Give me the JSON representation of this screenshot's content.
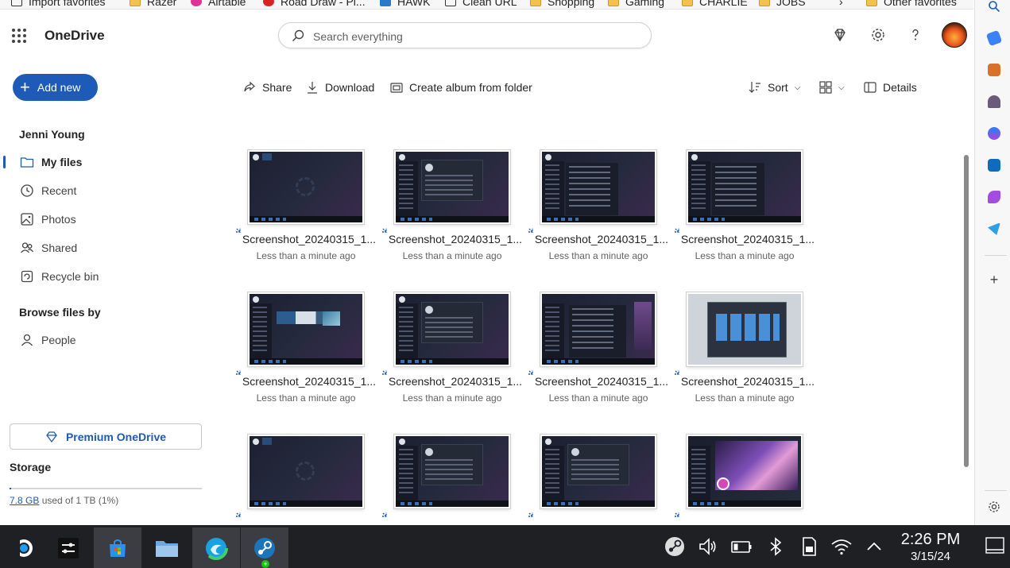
{
  "favorites_bar": {
    "items": [
      {
        "label": "Import favorites",
        "icon": "import-icon"
      },
      {
        "label": "Razer",
        "icon": "folder-icon"
      },
      {
        "label": "Airtable",
        "icon": "airtable-icon"
      },
      {
        "label": "Road Draw - Pl...",
        "icon": "roaddraw-icon"
      },
      {
        "label": "HAWK",
        "icon": "hawk-icon"
      },
      {
        "label": "Clean URL",
        "icon": "page-icon"
      },
      {
        "label": "Shopping",
        "icon": "folder-icon"
      },
      {
        "label": "Gaming",
        "icon": "folder-icon"
      },
      {
        "label": "CHARLIE",
        "icon": "folder-icon"
      },
      {
        "label": "JOBS",
        "icon": "folder-icon"
      },
      {
        "label": "Other favorites",
        "icon": "folder-icon"
      }
    ]
  },
  "header": {
    "app_name": "OneDrive",
    "search_placeholder": "Search everything"
  },
  "sidebar": {
    "add_new_label": "Add new",
    "user_name": "Jenni Young",
    "items": [
      {
        "label": "My files",
        "icon": "folder-icon",
        "active": true
      },
      {
        "label": "Recent",
        "icon": "clock-icon"
      },
      {
        "label": "Photos",
        "icon": "image-icon"
      },
      {
        "label": "Shared",
        "icon": "people-icon"
      },
      {
        "label": "Recycle bin",
        "icon": "trash-icon"
      }
    ],
    "browse_title": "Browse files by",
    "browse_items": [
      {
        "label": "People",
        "icon": "person-icon"
      }
    ],
    "premium_label": "Premium OneDrive",
    "storage_title": "Storage",
    "storage_used": "7.8 GB",
    "storage_rest": "used of 1 TB (1%)",
    "storage_fraction": 0.01
  },
  "commands": {
    "share": "Share",
    "download": "Download",
    "create_album": "Create album from folder",
    "sort": "Sort",
    "details": "Details"
  },
  "files": [
    {
      "name": "Screenshot_20240315_1...",
      "date": "Less than a minute ago",
      "thumb": "desktop"
    },
    {
      "name": "Screenshot_20240315_1...",
      "date": "Less than a minute ago",
      "thumb": "dialog"
    },
    {
      "name": "Screenshot_20240315_1...",
      "date": "Less than a minute ago",
      "thumb": "panel"
    },
    {
      "name": "Screenshot_20240315_1...",
      "date": "Less than a minute ago",
      "thumb": "panel"
    },
    {
      "name": "Screenshot_20240315_1...",
      "date": "Less than a minute ago",
      "thumb": "cards"
    },
    {
      "name": "Screenshot_20240315_1...",
      "date": "Less than a minute ago",
      "thumb": "dialog"
    },
    {
      "name": "Screenshot_20240315_1...",
      "date": "Less than a minute ago",
      "thumb": "settings"
    },
    {
      "name": "Screenshot_20240315_1...",
      "date": "Less than a minute ago",
      "thumb": "light"
    },
    {
      "name": "",
      "date": "",
      "thumb": "desktop"
    },
    {
      "name": "",
      "date": "",
      "thumb": "dialog"
    },
    {
      "name": "",
      "date": "",
      "thumb": "dialog"
    },
    {
      "name": "",
      "date": "",
      "thumb": "game"
    }
  ],
  "taskbar": {
    "apps": [
      "steam-deck-icon",
      "settings-sliders-icon",
      "store-icon",
      "file-explorer-icon",
      "edge-icon",
      "steam-icon"
    ],
    "tray": [
      "steam-tray-icon",
      "volume-icon",
      "battery-icon",
      "bluetooth-icon",
      "sd-card-icon",
      "wifi-icon",
      "chevron-up-icon"
    ],
    "time": "2:26 PM",
    "date": "3/15/24"
  },
  "colors": {
    "accent": "#1e5ab8",
    "taskbar": "#1f2023"
  }
}
